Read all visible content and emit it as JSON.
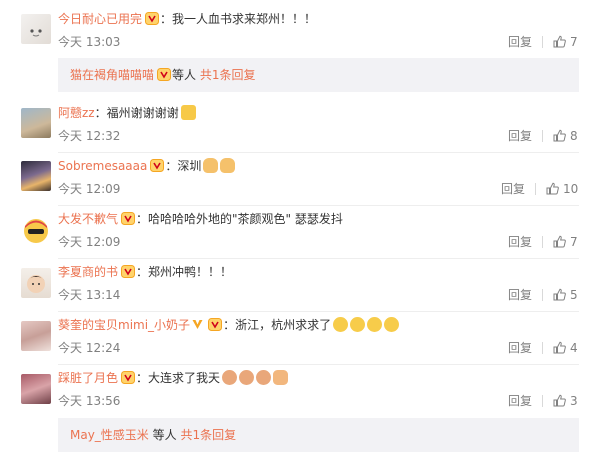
{
  "colors": {
    "accent": "#eb7350",
    "meta": "#808080",
    "badge": "#f5a623"
  },
  "icons": {
    "like": "thumb-up-icon",
    "badge": "vip-badge-icon"
  },
  "comments": [
    {
      "user": "今日耐心已用完",
      "text": "我一人血书求来郑州！！！",
      "time": "今天 13:03",
      "reply": "回复",
      "likes": "7",
      "sub": {
        "name": "猫在褐角喵喵喵",
        "mid": "等人",
        "count": "共1条回复"
      }
    },
    {
      "user": "阿戆zz",
      "text": "福州谢谢谢谢",
      "time": "今天 12:32",
      "reply": "回复",
      "likes": "8"
    },
    {
      "user": "Sobremesaaaa",
      "text": "深圳",
      "time": "今天 12:09",
      "reply": "回复",
      "likes": "10"
    },
    {
      "user": "大发不歉气",
      "text": "哈哈哈哈外地的\"茶颜观色\" 瑟瑟发抖",
      "time": "今天 12:09",
      "reply": "回复",
      "likes": "7"
    },
    {
      "user": "李夏商的书",
      "text": "郑州冲鸭！！！",
      "time": "今天 13:14",
      "reply": "回复",
      "likes": "5"
    },
    {
      "user": "葵奎的宝贝mimi_小奶子",
      "text": "浙江，杭州求求了",
      "time": "今天 12:24",
      "reply": "回复",
      "likes": "4"
    },
    {
      "user": "踩脏了月色",
      "text": "大连求了我天",
      "time": "今天 13:56",
      "reply": "回复",
      "likes": "3",
      "sub": {
        "name": "May_性感玉米",
        "mid": "等人",
        "count": "共1条回复"
      }
    }
  ]
}
